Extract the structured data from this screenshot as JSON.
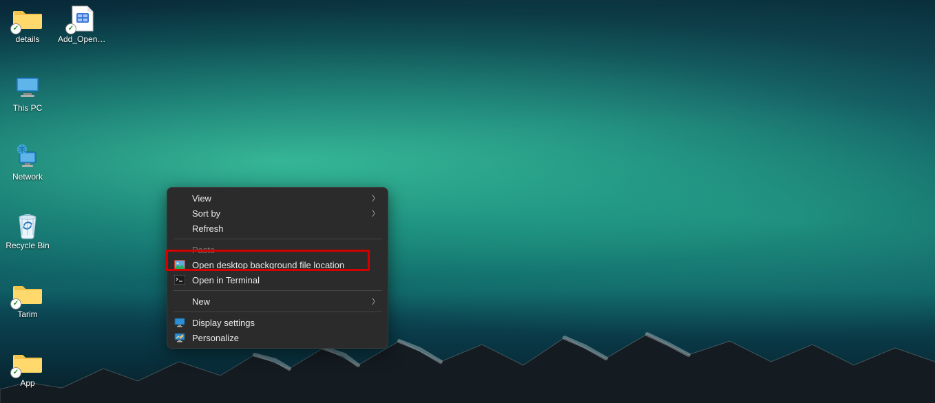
{
  "desktop": {
    "icons": [
      {
        "name": "details",
        "label": "details",
        "type": "folder",
        "sync": true
      },
      {
        "name": "add-open",
        "label": "Add_Open_...",
        "type": "regfile",
        "sync": true
      },
      {
        "name": "this-pc",
        "label": "This PC",
        "type": "pc",
        "sync": false
      },
      {
        "name": "network",
        "label": "Network",
        "type": "network",
        "sync": false
      },
      {
        "name": "recycle-bin",
        "label": "Recycle Bin",
        "type": "bin",
        "sync": false
      },
      {
        "name": "tarim",
        "label": "Tarim",
        "type": "folder",
        "sync": true
      },
      {
        "name": "app",
        "label": "App",
        "type": "folder",
        "sync": true
      }
    ]
  },
  "context_menu": {
    "view": "View",
    "sort_by": "Sort by",
    "refresh": "Refresh",
    "paste": "Paste",
    "open_bg_loc": "Open desktop background file location",
    "open_terminal": "Open in Terminal",
    "new": "New",
    "display_settings": "Display settings",
    "personalize": "Personalize",
    "highlighted": "open_bg_loc"
  },
  "colors": {
    "menu_bg": "#2b2b2b",
    "menu_text": "#eaeaea",
    "highlight_border": "#d40000"
  }
}
